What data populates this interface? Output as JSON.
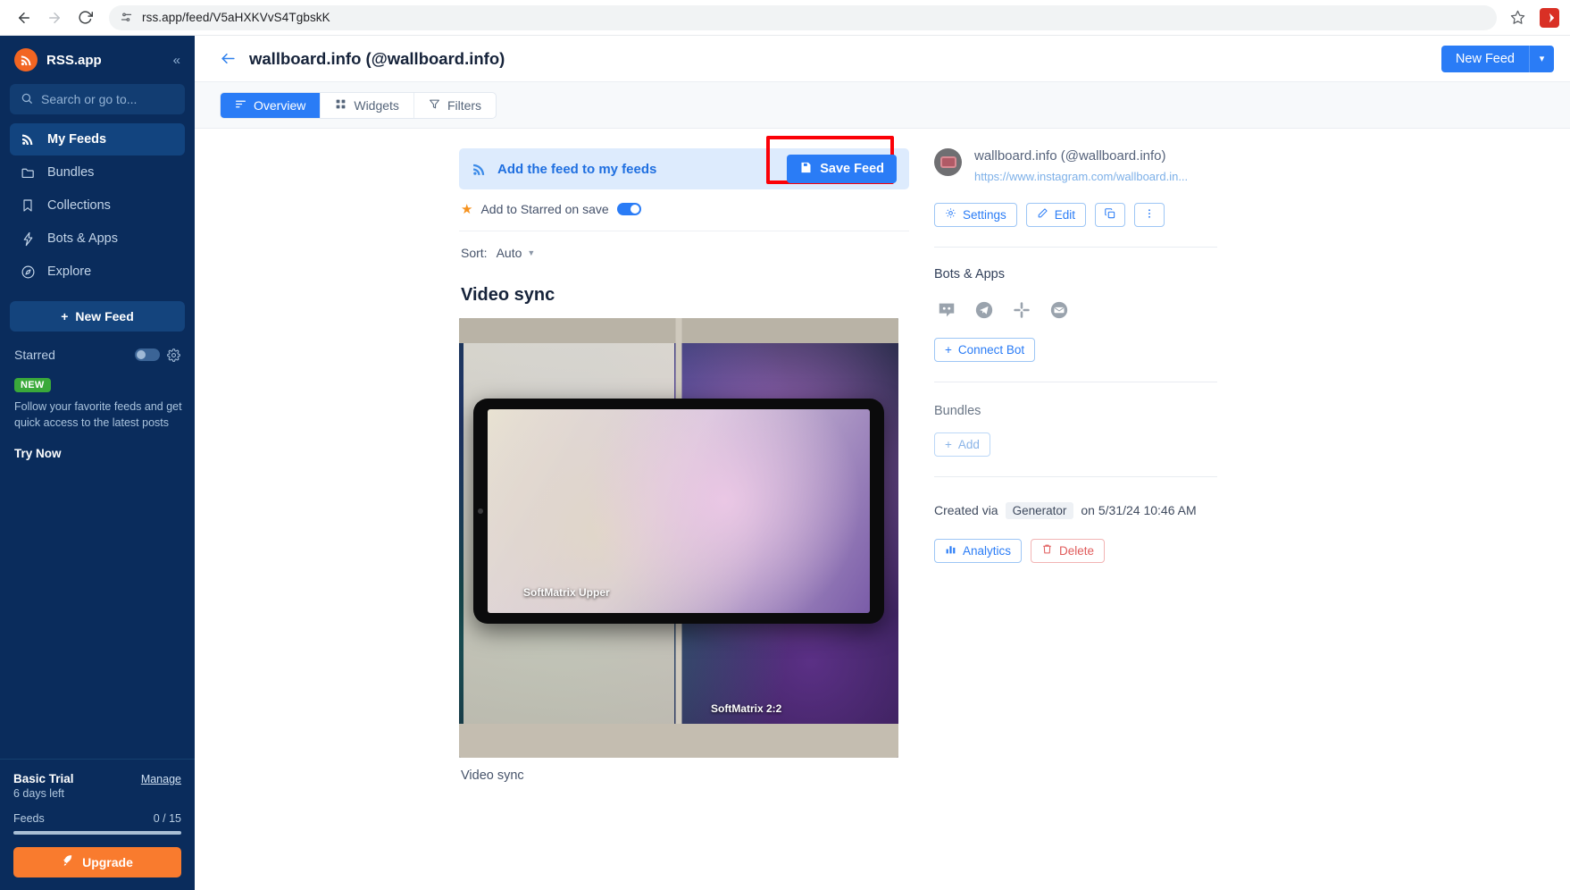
{
  "browser": {
    "url": "rss.app/feed/V5aHXKVvS4TgbskK",
    "back_icon": "arrow-left",
    "forward_icon": "arrow-right",
    "reload_icon": "reload",
    "site_settings_icon": "tune",
    "bookmark_icon": "star",
    "profile_icon": "profile"
  },
  "sidebar": {
    "brand": "RSS.app",
    "collapse_icon": "chevrons-left",
    "search_placeholder": "Search or go to...",
    "items": [
      {
        "label": "My Feeds",
        "icon": "rss-icon",
        "active": true
      },
      {
        "label": "Bundles",
        "icon": "folder-icon",
        "active": false
      },
      {
        "label": "Collections",
        "icon": "bookmark-icon",
        "active": false
      },
      {
        "label": "Bots & Apps",
        "icon": "bolt-icon",
        "active": false
      },
      {
        "label": "Explore",
        "icon": "compass-icon",
        "active": false
      }
    ],
    "new_feed_label": "New Feed",
    "starred_label": "Starred",
    "starred_toggle_on": false,
    "promo_badge": "NEW",
    "promo_text": "Follow your favorite feeds and get quick access to the latest posts",
    "try_now": "Try Now",
    "plan_name": "Basic Trial",
    "manage_link": "Manage",
    "days_left": "6 days left",
    "feeds_label": "Feeds",
    "feeds_count": "0 / 15",
    "upgrade_label": "Upgrade"
  },
  "header": {
    "title": "wallboard.info (@wallboard.info)",
    "back_icon": "arrow-left",
    "new_feed_label": "New Feed",
    "new_feed_caret": "▾"
  },
  "tabs": [
    {
      "label": "Overview",
      "icon": "list-icon",
      "active": true
    },
    {
      "label": "Widgets",
      "icon": "grid-icon",
      "active": false
    },
    {
      "label": "Filters",
      "icon": "funnel-icon",
      "active": false
    }
  ],
  "main": {
    "add_banner_text": "Add the feed to my feeds",
    "save_feed_label": "Save Feed",
    "starred_on_save_label": "Add to Starred on save",
    "starred_on_save_on": true,
    "sort_label": "Sort:",
    "sort_value": "Auto",
    "post_title": "Video sync",
    "post_caption_below": "Video sync",
    "media_caption_upper": "SoftMatrix Upper",
    "media_caption_lower": "SoftMatrix 2:2",
    "highlight_color": "#fb0007"
  },
  "details": {
    "feed_name": "wallboard.info (@wallboard.info)",
    "feed_url": "https://www.instagram.com/wallboard.in...",
    "settings_label": "Settings",
    "edit_label": "Edit",
    "copy_icon": "copy-icon",
    "more_icon": "more-vertical-icon",
    "bots_title": "Bots & Apps",
    "bot_icons": [
      "discord-icon",
      "telegram-icon",
      "slack-icon",
      "email-icon"
    ],
    "connect_bot_label": "Connect Bot",
    "bundles_title": "Bundles",
    "add_label": "Add",
    "created_prefix": "Created via",
    "created_source": "Generator",
    "created_suffix": "on 5/31/24 10:46 AM",
    "analytics_label": "Analytics",
    "delete_label": "Delete"
  }
}
